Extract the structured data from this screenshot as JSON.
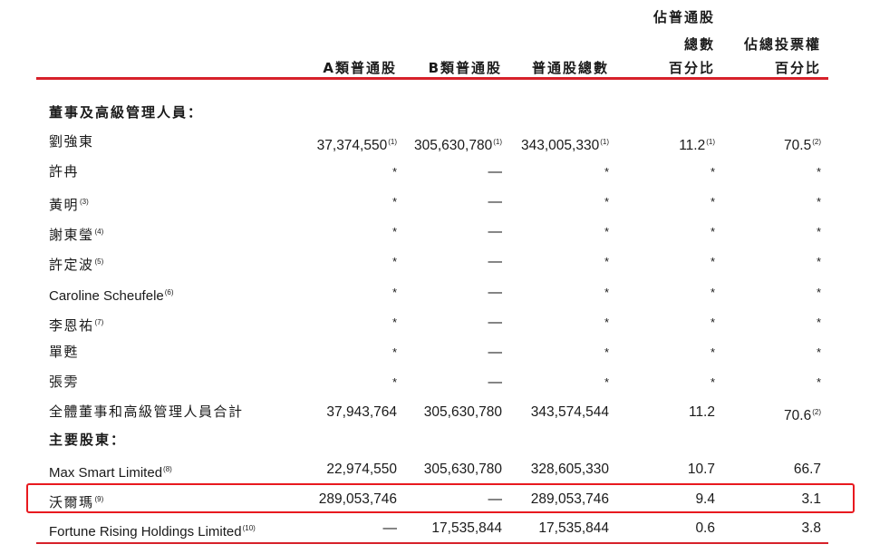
{
  "headers": {
    "col_a": "A類普通股",
    "col_b": "B類普通股",
    "col_total": "普通股總數",
    "col_pct_shares": [
      "佔普通股",
      "總數",
      "百分比"
    ],
    "col_pct_votes": [
      "佔總投票權",
      "百分比"
    ]
  },
  "sections": {
    "directors": "董事及高級管理人員：",
    "major": "主要股東："
  },
  "rows": [
    {
      "name": "劉強東",
      "name_sup": "",
      "a": "37,374,550",
      "a_sup": "(1)",
      "b": "305,630,780",
      "b_sup": "(1)",
      "total": "343,005,330",
      "total_sup": "(1)",
      "pct_shares": "11.2",
      "pct_shares_sup": "(1)",
      "pct_votes": "70.5",
      "pct_votes_sup": "(2)"
    },
    {
      "name": "許冉",
      "name_sup": "",
      "a": "*",
      "a_sup": "",
      "b": "—",
      "b_sup": "",
      "total": "*",
      "total_sup": "",
      "pct_shares": "*",
      "pct_shares_sup": "",
      "pct_votes": "*",
      "pct_votes_sup": ""
    },
    {
      "name": "黃明",
      "name_sup": "(3)",
      "a": "*",
      "a_sup": "",
      "b": "—",
      "b_sup": "",
      "total": "*",
      "total_sup": "",
      "pct_shares": "*",
      "pct_shares_sup": "",
      "pct_votes": "*",
      "pct_votes_sup": ""
    },
    {
      "name": "謝東瑩",
      "name_sup": "(4)",
      "a": "*",
      "a_sup": "",
      "b": "—",
      "b_sup": "",
      "total": "*",
      "total_sup": "",
      "pct_shares": "*",
      "pct_shares_sup": "",
      "pct_votes": "*",
      "pct_votes_sup": ""
    },
    {
      "name": "許定波",
      "name_sup": "(5)",
      "a": "*",
      "a_sup": "",
      "b": "—",
      "b_sup": "",
      "total": "*",
      "total_sup": "",
      "pct_shares": "*",
      "pct_shares_sup": "",
      "pct_votes": "*",
      "pct_votes_sup": ""
    },
    {
      "name": "Caroline Scheufele",
      "name_sup": "(6)",
      "a": "*",
      "a_sup": "",
      "b": "—",
      "b_sup": "",
      "total": "*",
      "total_sup": "",
      "pct_shares": "*",
      "pct_shares_sup": "",
      "pct_votes": "*",
      "pct_votes_sup": ""
    },
    {
      "name": "李恩祐",
      "name_sup": "(7)",
      "a": "*",
      "a_sup": "",
      "b": "—",
      "b_sup": "",
      "total": "*",
      "total_sup": "",
      "pct_shares": "*",
      "pct_shares_sup": "",
      "pct_votes": "*",
      "pct_votes_sup": ""
    },
    {
      "name": "單甦",
      "name_sup": "",
      "a": "*",
      "a_sup": "",
      "b": "—",
      "b_sup": "",
      "total": "*",
      "total_sup": "",
      "pct_shares": "*",
      "pct_shares_sup": "",
      "pct_votes": "*",
      "pct_votes_sup": ""
    },
    {
      "name": "張雱",
      "name_sup": "",
      "a": "*",
      "a_sup": "",
      "b": "—",
      "b_sup": "",
      "total": "*",
      "total_sup": "",
      "pct_shares": "*",
      "pct_shares_sup": "",
      "pct_votes": "*",
      "pct_votes_sup": ""
    },
    {
      "name": "全體董事和高級管理人員合計",
      "name_sup": "",
      "a": "37,943,764",
      "a_sup": "",
      "b": "305,630,780",
      "b_sup": "",
      "total": "343,574,544",
      "total_sup": "",
      "pct_shares": "11.2",
      "pct_shares_sup": "",
      "pct_votes": "70.6",
      "pct_votes_sup": "(2)"
    },
    {
      "name": "Max Smart Limited",
      "name_sup": "(8)",
      "a": "22,974,550",
      "a_sup": "",
      "b": "305,630,780",
      "b_sup": "",
      "total": "328,605,330",
      "total_sup": "",
      "pct_shares": "10.7",
      "pct_shares_sup": "",
      "pct_votes": "66.7",
      "pct_votes_sup": ""
    },
    {
      "name": "沃爾瑪",
      "name_sup": "(9)",
      "a": "289,053,746",
      "a_sup": "",
      "b": "—",
      "b_sup": "",
      "total": "289,053,746",
      "total_sup": "",
      "pct_shares": "9.4",
      "pct_shares_sup": "",
      "pct_votes": "3.1",
      "pct_votes_sup": ""
    },
    {
      "name": "Fortune Rising Holdings Limited",
      "name_sup": "(10)",
      "a": "—",
      "a_sup": "",
      "b": "17,535,844",
      "b_sup": "",
      "total": "17,535,844",
      "total_sup": "",
      "pct_shares": "0.6",
      "pct_shares_sup": "",
      "pct_votes": "3.8",
      "pct_votes_sup": ""
    }
  ],
  "colors": {
    "rule": "#d7212a",
    "highlight": "#e8191f",
    "text": "#1a1a1a"
  }
}
